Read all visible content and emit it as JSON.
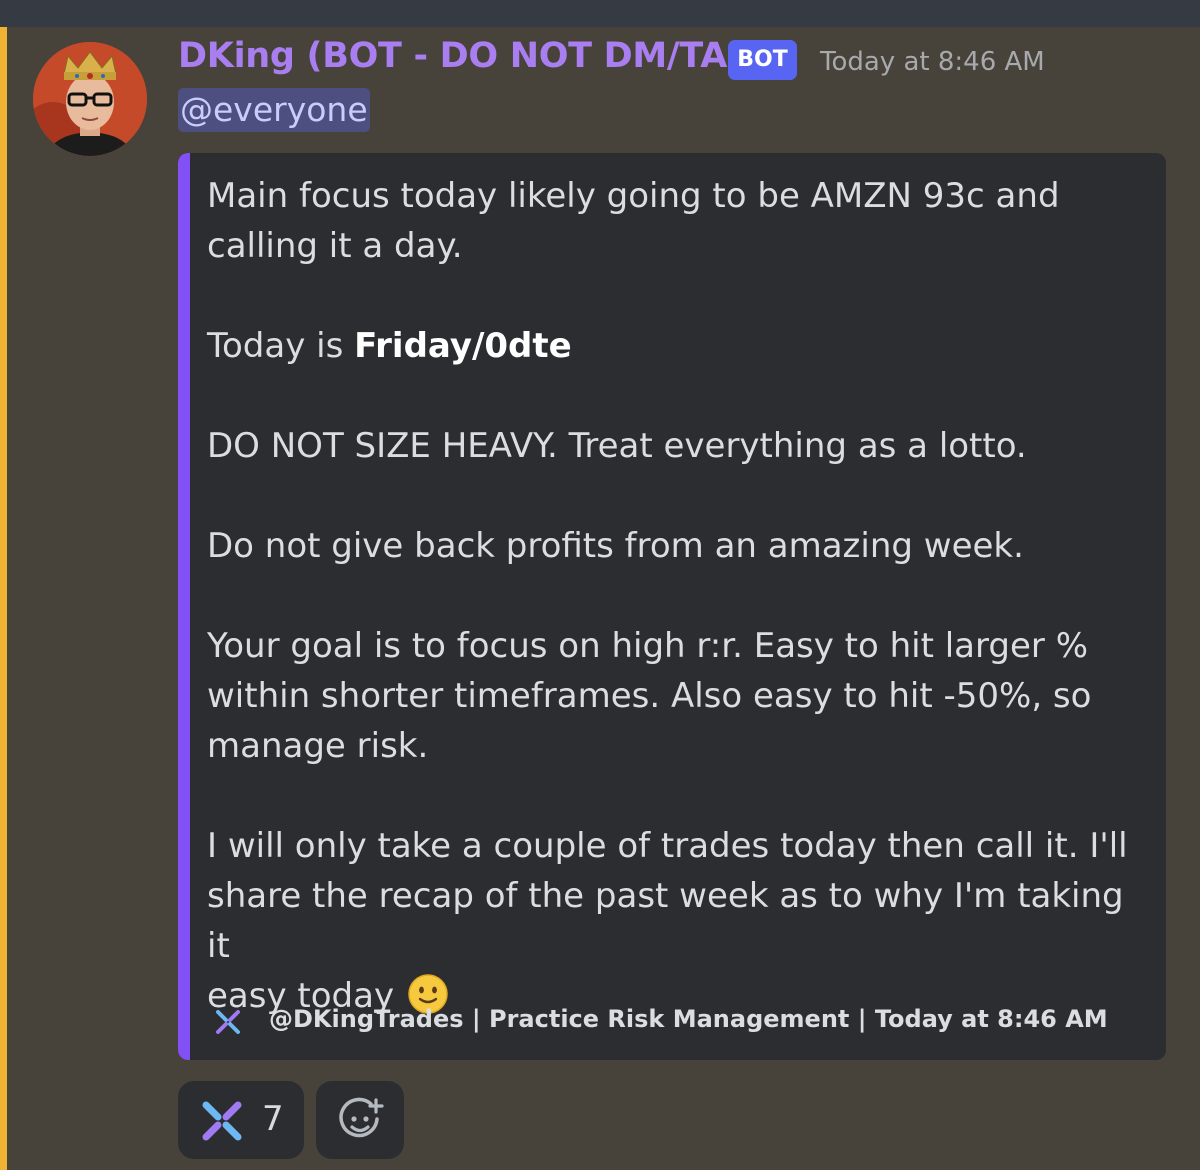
{
  "message": {
    "username": "DKing (BOT - DO NOT DM/TAG)",
    "bot_tag": "BOT",
    "timestamp": "Today at 8:46 AM",
    "mention": "@everyone"
  },
  "embed": {
    "line1": "Main focus today likely going to be AMZN 93c and",
    "line2": "calling it a day.",
    "line3_prefix": "Today is ",
    "line3_bold": "Friday/0dte",
    "line4": "DO NOT SIZE HEAVY. Treat everything as a lotto.",
    "line5": "Do not give back profits from an amazing week.",
    "line6": "Your goal is to focus on high r:r. Easy to hit larger %",
    "line7": "within shorter timeframes. Also easy to hit -50%, so",
    "line8": "manage risk.",
    "line9": "I will only take a couple of trades today then call it. I'll",
    "line10": "share the recap of the past week as to why I'm taking it",
    "line11": "easy today ",
    "emoji": "slightly-smiling-face",
    "footer": "@DKingTrades | Practice Risk Management | Today at 8:46 AM",
    "accent_color": "#8350f6"
  },
  "reactions": [
    {
      "emoji": "server-logo-emoji",
      "count": "7"
    },
    {
      "emoji": "add-reaction-icon",
      "count": ""
    }
  ],
  "colors": {
    "background": "#47433a",
    "username": "#a97ef0",
    "bot_tag": "#5865f2",
    "mention_bar": "#f0b232"
  }
}
